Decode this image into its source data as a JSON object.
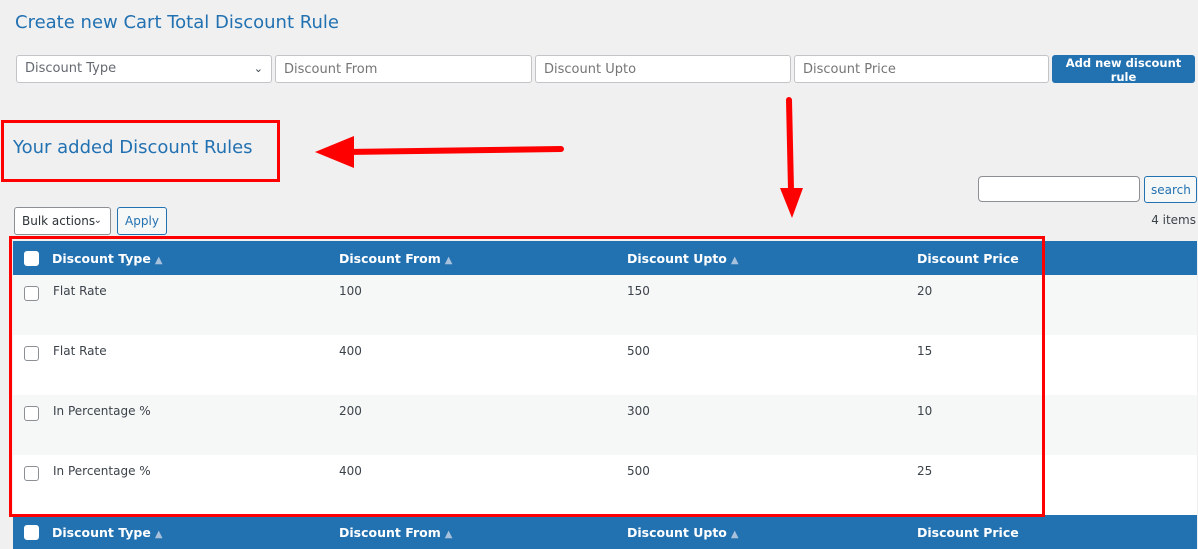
{
  "create_title": "Create new Cart Total Discount Rule",
  "form": {
    "type_placeholder": "Discount Type",
    "from_placeholder": "Discount From",
    "upto_placeholder": "Discount Upto",
    "price_placeholder": "Discount Price",
    "add_button": "Add new discount rule"
  },
  "list_title": "Your added Discount Rules",
  "search": {
    "value": "",
    "button": "search"
  },
  "bulk": {
    "selected": "Bulk actions",
    "apply": "Apply"
  },
  "item_count": "4 items",
  "columns": [
    "Discount Type",
    "Discount From",
    "Discount Upto",
    "Discount Price"
  ],
  "rows": [
    [
      "Flat Rate",
      "100",
      "150",
      "20"
    ],
    [
      "Flat Rate",
      "400",
      "500",
      "15"
    ],
    [
      "In Percentage %",
      "200",
      "300",
      "10"
    ],
    [
      "In Percentage %",
      "400",
      "500",
      "25"
    ]
  ],
  "colors": {
    "accent": "#2271b1",
    "annotation": "#ff0000"
  }
}
